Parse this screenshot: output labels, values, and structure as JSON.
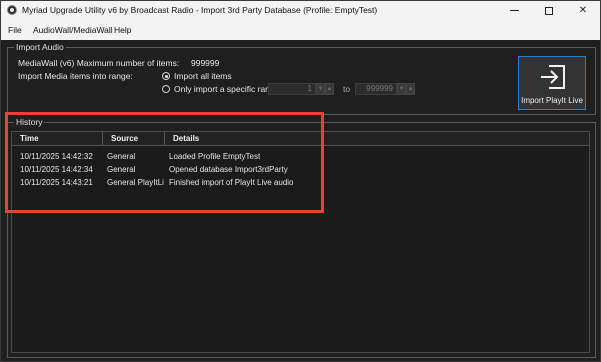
{
  "window": {
    "title": "Myriad Upgrade Utility v6 by Broadcast Radio - Import 3rd Party Database (Profile: EmptyTest)"
  },
  "menu": {
    "items": [
      "File",
      "AudioWall/MediaWall",
      "Help"
    ]
  },
  "import_audio": {
    "group_label": "Import Audio",
    "max_items_label": "MediaWall (v6) Maximum number of items:",
    "max_items_value": "999999",
    "range_label": "Import Media items into range:",
    "radio_all_label": "Import all items",
    "radio_all_checked": true,
    "radio_range_label": "Only import a specific range:",
    "radio_range_checked": false,
    "range_from": "1",
    "range_to_label": "to",
    "range_to": "999999",
    "import_button_label": "Import PlayIt Live",
    "import_button_icon": "import-arrow-icon"
  },
  "history": {
    "group_label": "History",
    "columns": [
      "Time",
      "Source",
      "Details"
    ],
    "rows": [
      {
        "time": "10/11/2025 14:42:32",
        "source": "General",
        "details": "Loaded Profile EmptyTest"
      },
      {
        "time": "10/11/2025 14:42:34",
        "source": "General",
        "details": "Opened database Import3rdParty"
      },
      {
        "time": "10/11/2025 14:43:21",
        "source": "General PlayItLi",
        "details": "Finished import of PlayIt Live audio"
      }
    ]
  },
  "colors": {
    "highlight_border": "#e8413c",
    "import_button_border": "#2f7dd1",
    "window_background": "#1f1f1f"
  }
}
